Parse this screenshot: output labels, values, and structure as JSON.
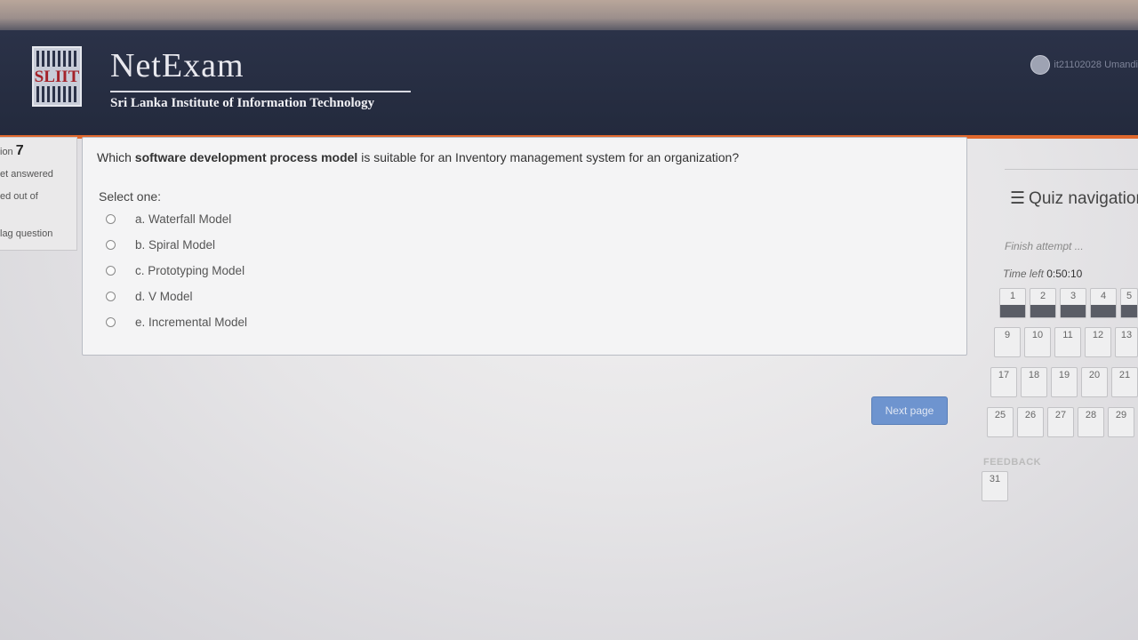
{
  "header": {
    "logo_text": "SLIIT",
    "brand": "NetExam",
    "institute": "Sri Lanka Institute of Information Technology",
    "user_name": "it21102028 Umandi"
  },
  "question_info": {
    "number_prefix": "ion",
    "number": "7",
    "state": "et answered",
    "marked_out_of": "ed out of",
    "flag": "lag question"
  },
  "question": {
    "text_part1": "Which ",
    "text_bold": "software development process model",
    "text_part2": " is suitable for an Inventory management system for an organization?",
    "prompt": "Select one:",
    "options": [
      {
        "label": "a. Waterfall Model"
      },
      {
        "label": "b. Spiral Model"
      },
      {
        "label": "c. Prototyping Model"
      },
      {
        "label": "d. V Model"
      },
      {
        "label": "e. Incremental Model"
      }
    ]
  },
  "next_button": "Next page",
  "quiz_nav": {
    "title": "Quiz navigation",
    "finish": "Finish attempt ...",
    "time_label": "Time left",
    "time_value": "0:50:10",
    "rows": [
      [
        "1",
        "2",
        "3",
        "4",
        "5"
      ],
      [
        "9",
        "10",
        "11",
        "12",
        "13"
      ],
      [
        "17",
        "18",
        "19",
        "20",
        "21"
      ],
      [
        "25",
        "26",
        "27",
        "28",
        "29"
      ]
    ],
    "feedback_label": "FEEDBACK",
    "feedback_cell": "31"
  }
}
